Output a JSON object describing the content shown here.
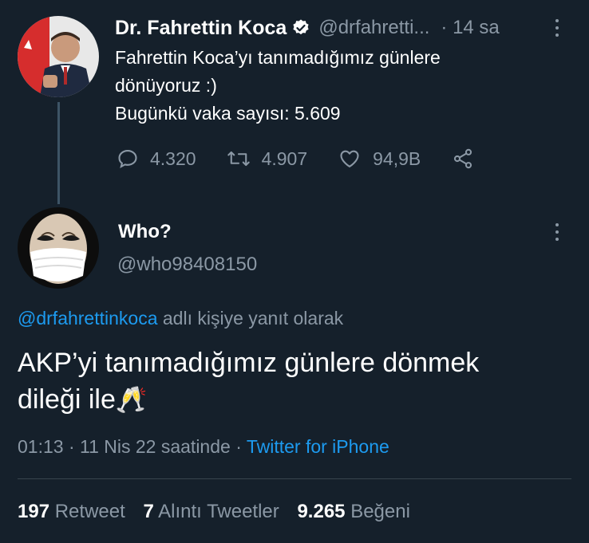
{
  "parent_tweet": {
    "author_name": "Dr. Fahrettin Koca",
    "handle": "@drfahretti...",
    "time": "· 14 sa",
    "text_line1": "Fahrettin Koca’yı tanımadığımız günlere",
    "text_line2": "dönüyoruz :)",
    "text_line3": "Bugünkü vaka sayısı: 5.609",
    "replies": "4.320",
    "retweets": "4.907",
    "likes": "94,9B",
    "icons": [
      "verified-badge-icon",
      "more-icon",
      "reply-icon",
      "retweet-icon",
      "like-icon",
      "share-icon"
    ]
  },
  "reply_tweet": {
    "author_name": "Who?",
    "handle": "@who98408150",
    "reply_to_handle": "@drfahrettinkoca",
    "reply_to_suffix": " adlı kişiye yanıt olarak",
    "text_line1": "AKP’yi tanımadığımız günlere dönmek",
    "text_line2": "dileği ile",
    "emoji": "🥂",
    "timestamp": "01:13 · 11 Nis 22 saatinde · ",
    "source": "Twitter for iPhone"
  },
  "stats": {
    "retweet_count": "197",
    "retweet_label": "Retweet",
    "quote_count": "7",
    "quote_label": "Alıntı Tweetler",
    "like_count": "9.265",
    "like_label": "Beğeni"
  },
  "colors": {
    "background": "#15202b",
    "muted": "#8b98a5",
    "accent": "#1d9bf0",
    "divider": "#38444d"
  }
}
